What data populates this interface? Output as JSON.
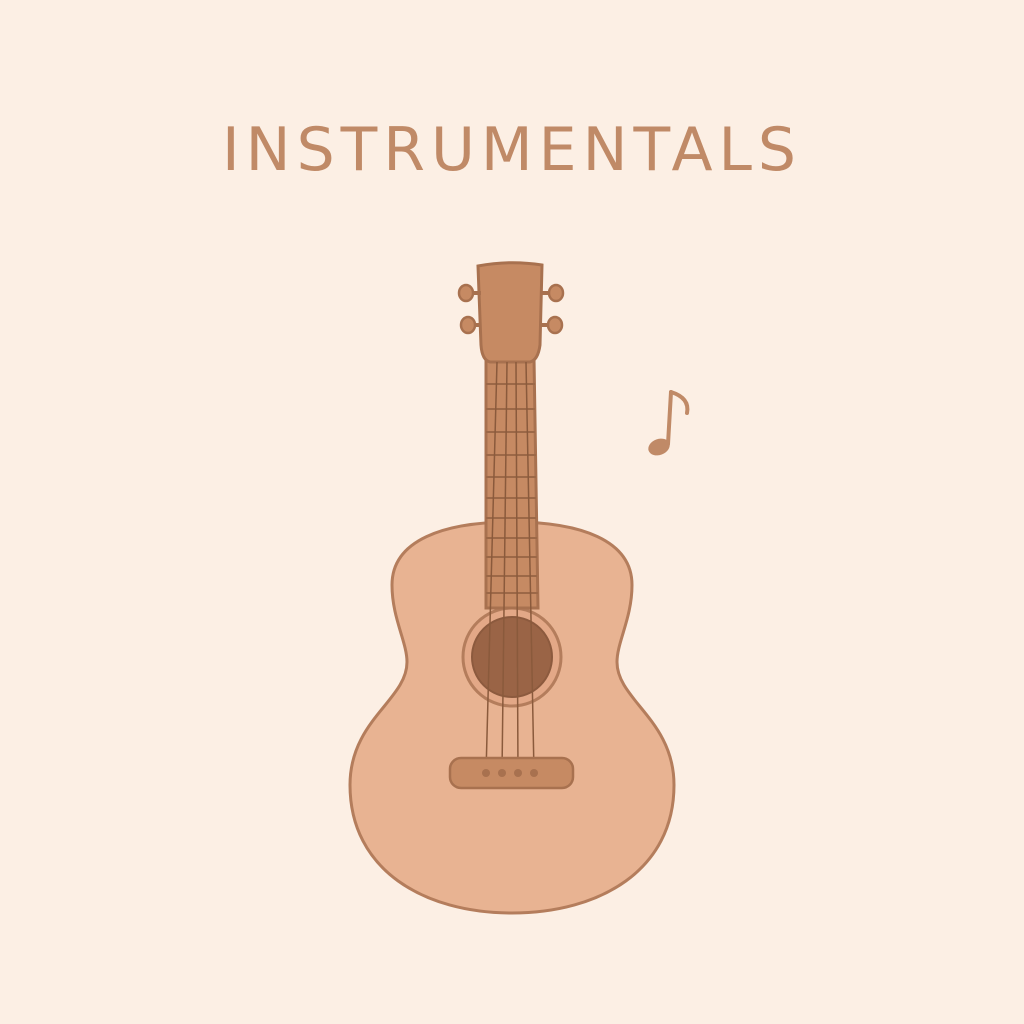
{
  "cover": {
    "title": "INSTRUMENTALS",
    "illustration": "acoustic-guitar",
    "accent_icon": "music-note-icon"
  },
  "colors": {
    "background": "#fcefe4",
    "title_text": "#c08a67",
    "guitar_body": "#e8b392",
    "outline": "#b47d5c",
    "neck": "#c68a63",
    "sound_hole": "#9a6446"
  }
}
